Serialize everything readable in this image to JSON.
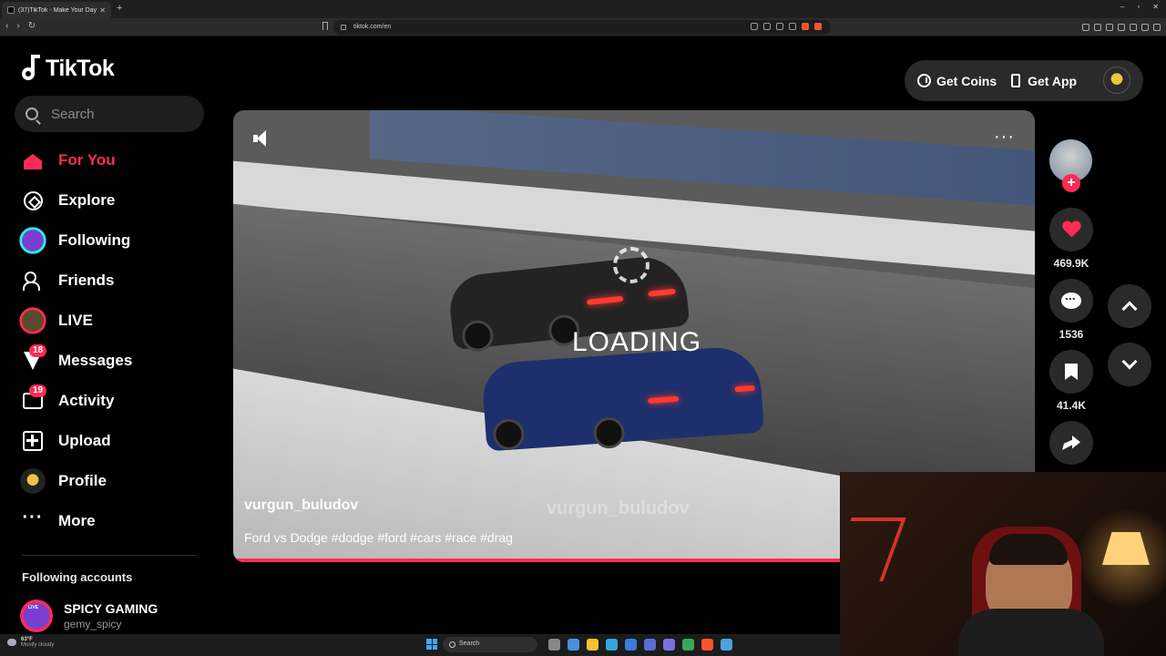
{
  "browser": {
    "tab_title": "(37)TikTok - Make Your Day",
    "tab_close": "✕",
    "new_tab": "+",
    "window_controls": [
      "–",
      "▫",
      "✕"
    ],
    "nav": [
      "‹",
      "›",
      "↻"
    ],
    "url": "tiktok.com/en"
  },
  "header": {
    "logo_text": "TikTok",
    "get_coins": "Get Coins",
    "get_app": "Get App"
  },
  "search": {
    "placeholder": "Search"
  },
  "sidebar": {
    "items": [
      {
        "label": "For You",
        "icon": "home-icon",
        "active": true
      },
      {
        "label": "Explore",
        "icon": "compass-icon"
      },
      {
        "label": "Following",
        "icon": "following-avatar-icon"
      },
      {
        "label": "Friends",
        "icon": "friends-icon"
      },
      {
        "label": "LIVE",
        "icon": "live-avatar-icon"
      },
      {
        "label": "Messages",
        "icon": "messages-icon",
        "badge": "18"
      },
      {
        "label": "Activity",
        "icon": "activity-icon",
        "badge": "19"
      },
      {
        "label": "Upload",
        "icon": "upload-icon"
      },
      {
        "label": "Profile",
        "icon": "profile-avatar-icon"
      },
      {
        "label": "More",
        "icon": "more-icon"
      }
    ],
    "following_title": "Following accounts",
    "accounts": [
      {
        "name": "SPICY GAMING",
        "handle": "gemy_spicy",
        "live_tag": "LIVE"
      }
    ]
  },
  "video": {
    "status_text": "LOADING",
    "watermark": "vurgun_buludov",
    "username": "vurgun_buludov",
    "caption": "Ford vs Dodge #dodge #ford #cars #race #drag"
  },
  "actions": {
    "likes": "469.9K",
    "comments": "1536",
    "saves": "41.4K",
    "follow_plus": "+"
  },
  "taskbar": {
    "temp": "63°F",
    "condition": "Mostly cloudy",
    "search": "Search"
  },
  "colors": {
    "accent": "#fe2c55",
    "background": "#000000",
    "button_bg": "#2a2a2a"
  }
}
